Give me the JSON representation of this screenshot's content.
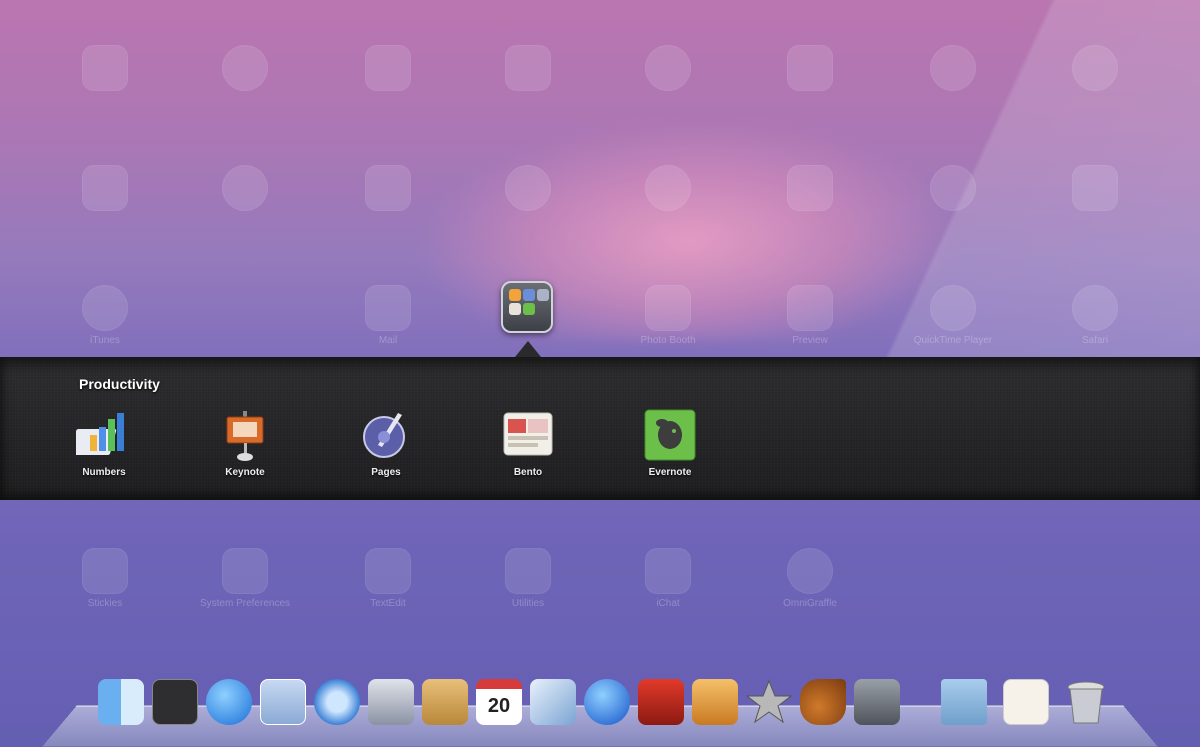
{
  "folder": {
    "title": "Productivity",
    "apps": [
      {
        "label": "Numbers",
        "icon": "numbers-icon"
      },
      {
        "label": "Keynote",
        "icon": "keynote-icon"
      },
      {
        "label": "Pages",
        "icon": "pages-icon"
      },
      {
        "label": "Bento",
        "icon": "bento-icon"
      },
      {
        "label": "Evernote",
        "icon": "evernote-icon"
      }
    ]
  },
  "background_apps": {
    "row3": [
      "iTunes",
      "Mail",
      "Photo Booth",
      "Preview",
      "QuickTime Player",
      "Safari"
    ],
    "row4": [
      "Stickies",
      "System Preferences",
      "TextEdit",
      "Utilities",
      "iChat",
      "OmniGraffle"
    ]
  },
  "dock": [
    {
      "icon": "finder-icon"
    },
    {
      "icon": "dashboard-icon"
    },
    {
      "icon": "app-store-icon"
    },
    {
      "icon": "mail-icon"
    },
    {
      "icon": "safari-icon"
    },
    {
      "icon": "facetime-icon"
    },
    {
      "icon": "address-book-icon"
    },
    {
      "icon": "ical-icon",
      "text": "20"
    },
    {
      "icon": "preview-icon"
    },
    {
      "icon": "itunes-icon"
    },
    {
      "icon": "photo-booth-icon"
    },
    {
      "icon": "iphoto-icon"
    },
    {
      "icon": "imovie-icon"
    },
    {
      "icon": "garageband-icon"
    },
    {
      "icon": "system-preferences-icon"
    },
    {
      "icon": "folder-icon"
    },
    {
      "icon": "textedit-icon"
    },
    {
      "icon": "trash-icon"
    }
  ],
  "colors": {
    "panel": "#1f1f21",
    "accent_evernote": "#6cc04a"
  }
}
